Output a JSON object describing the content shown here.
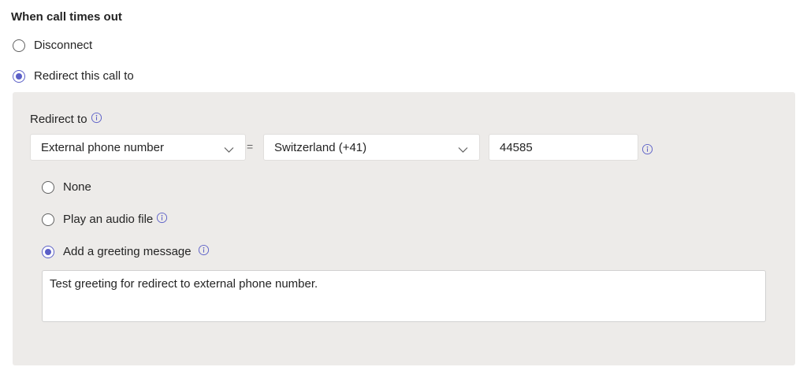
{
  "section": {
    "title": "When call times out"
  },
  "timeout_options": [
    {
      "label": "Disconnect",
      "selected": false
    },
    {
      "label": "Redirect this call to",
      "selected": true
    }
  ],
  "redirect": {
    "label": "Redirect to",
    "target_type": "External phone number",
    "separator": "=",
    "country": "Switzerland (+41)",
    "phone_number": "44585"
  },
  "greeting_options": [
    {
      "label": "None",
      "selected": false
    },
    {
      "label": "Play an audio file",
      "selected": false
    },
    {
      "label": "Add a greeting message",
      "selected": true
    }
  ],
  "greeting_message": "Test greeting for redirect to external phone number.",
  "colors": {
    "accent": "#5b5fc7",
    "panel_bg": "#edebe9",
    "text": "#242424"
  },
  "icons": [
    "info-icon",
    "chevron-down-icon"
  ]
}
